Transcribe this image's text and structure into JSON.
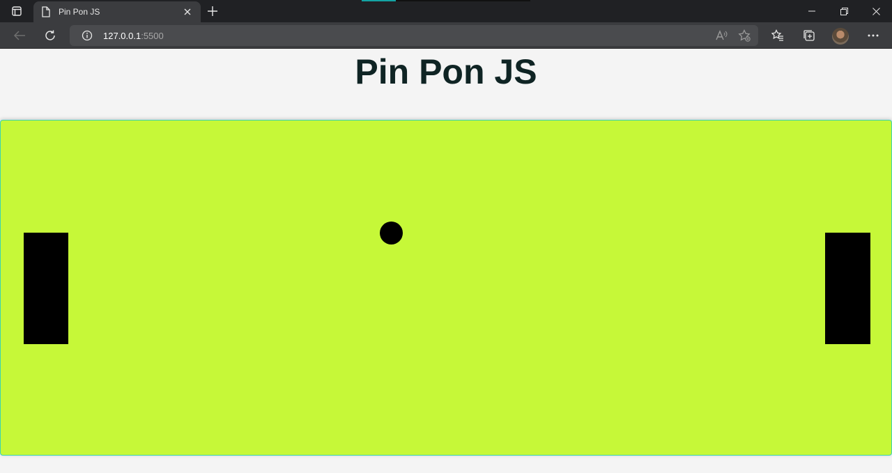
{
  "browser": {
    "tab": {
      "title": "Pin Pon JS"
    },
    "address": {
      "host": "127.0.0.1",
      "port": ":5500"
    },
    "icons": {
      "tab_actions": "tab-actions-icon",
      "favicon": "page-icon",
      "tab_close": "close-icon",
      "new_tab": "plus-icon",
      "back": "back-arrow-icon",
      "refresh": "refresh-icon",
      "site_info": "info-icon",
      "read_aloud": "read-aloud-icon",
      "add_favorite": "add-favorite-icon",
      "favorites": "favorites-icon",
      "collections": "collections-icon",
      "profile": "avatar",
      "menu": "more-icon"
    }
  },
  "page": {
    "heading": "Pin Pon JS"
  },
  "game": {
    "board_color": "#c6f838",
    "border_color": "#39d4b0",
    "paddle_color": "#000000",
    "ball_color": "#000000"
  }
}
